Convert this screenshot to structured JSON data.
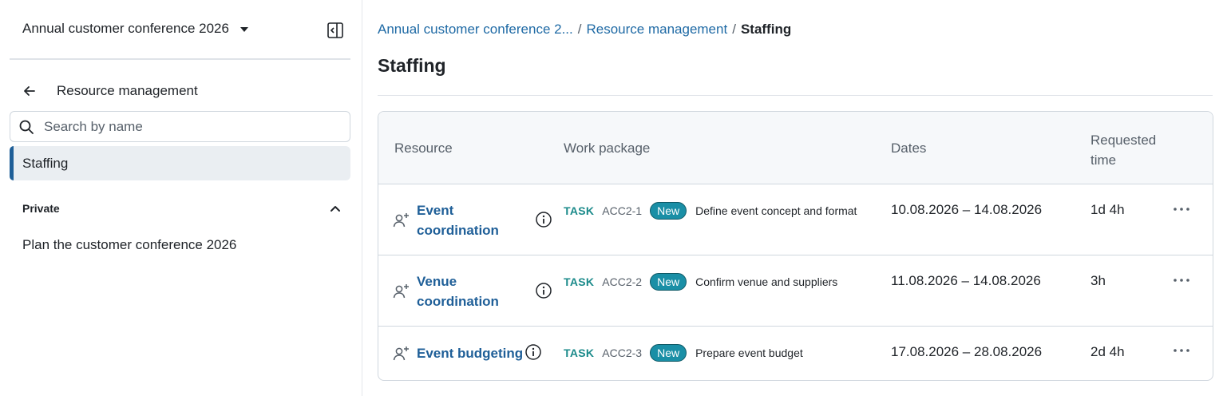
{
  "sidebar": {
    "project_name": "Annual customer conference 2026",
    "back_label": "Resource management",
    "search_placeholder": "Search by name",
    "active_item": "Staffing",
    "section_title": "Private",
    "private_items": [
      "Plan the customer conference 2026"
    ]
  },
  "main": {
    "breadcrumb": {
      "project": "Annual customer conference 2...",
      "separator": "/",
      "parent": "Resource management",
      "current": "Staffing"
    },
    "title": "Staffing",
    "table": {
      "headers": {
        "resource": "Resource",
        "work_package": "Work package",
        "dates": "Dates",
        "requested_line1": "Requested",
        "requested_line2": "time"
      },
      "rows": [
        {
          "resource": "Event coordination",
          "type": "TASK",
          "id": "ACC2-1",
          "status": "New",
          "subject": "Define event concept and format",
          "dates": "10.08.2026 – 14.08.2026",
          "requested": "1d 4h"
        },
        {
          "resource": "Venue coordination",
          "type": "TASK",
          "id": "ACC2-2",
          "status": "New",
          "subject": "Confirm venue and suppliers",
          "dates": "11.08.2026 – 14.08.2026",
          "requested": "3h"
        },
        {
          "resource": "Event budgeting",
          "type": "TASK",
          "id": "ACC2-3",
          "status": "New",
          "subject": "Prepare event budget",
          "dates": "17.08.2026 – 28.08.2026",
          "requested": "2d 4h"
        }
      ]
    }
  },
  "colors": {
    "link": "#1f6aa5",
    "active_bar": "#1f5f98",
    "task_type": "#1a8a8a",
    "status_badge": "#1a8fa6"
  },
  "icons": [
    "sidebar-collapse-icon",
    "arrow-left-icon",
    "search-icon",
    "chevron-up-icon",
    "user-plus-icon",
    "info-icon",
    "more-horizontal-icon"
  ]
}
